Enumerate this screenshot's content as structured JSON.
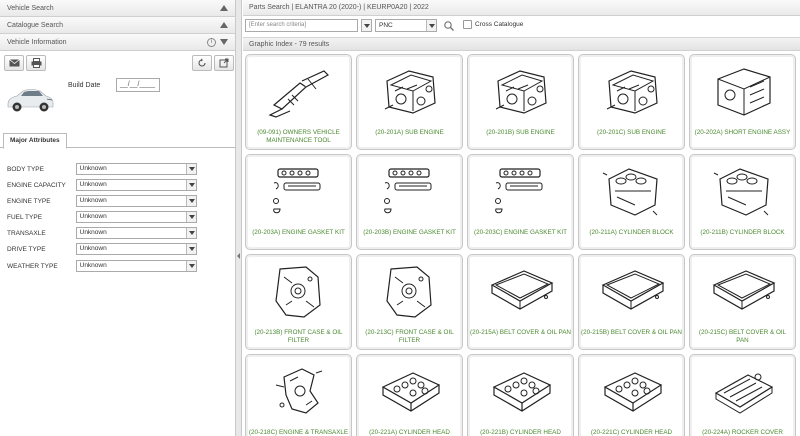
{
  "left_panel": {
    "accordions": [
      {
        "title": "Vehicle Search"
      },
      {
        "title": "Catalogue Search"
      },
      {
        "title": "Vehicle Information"
      }
    ],
    "build_date_label": "Build Date",
    "build_date_value": "__/__/____",
    "tab_label": "Major Attributes",
    "attributes": [
      {
        "label": "BODY TYPE",
        "value": "Unknown"
      },
      {
        "label": "ENGINE CAPACITY",
        "value": "Unknown"
      },
      {
        "label": "ENGINE TYPE",
        "value": "Unknown"
      },
      {
        "label": "FUEL TYPE",
        "value": "Unknown"
      },
      {
        "label": "TRANSAXLE",
        "value": "Unknown"
      },
      {
        "label": "DRIVE TYPE",
        "value": "Unknown"
      },
      {
        "label": "WEATHER TYPE",
        "value": "Unknown"
      }
    ]
  },
  "right_panel": {
    "breadcrumb": "Parts Search | ELANTRA 20 (2020-) | KEURP0A20 | 2022",
    "search_placeholder": "[Enter search criteria]",
    "search_type": "PNC",
    "cross_catalogue_label": "Cross Catalogue",
    "graphic_index_label": "Graphic Index - 79 results",
    "parts": [
      {
        "label": "(09-091) OWNERS VEHICLE MAINTENANCE TOOL",
        "icon": "jack-icon"
      },
      {
        "label": "(20-201A) SUB ENGINE",
        "icon": "engine-icon"
      },
      {
        "label": "(20-201B) SUB ENGINE",
        "icon": "engine-icon"
      },
      {
        "label": "(20-201C) SUB ENGINE",
        "icon": "engine-icon"
      },
      {
        "label": "(20-202A) SHORT ENGINE ASSY",
        "icon": "short-engine-icon"
      },
      {
        "label": "(20-203A) ENGINE GASKET KIT",
        "icon": "gasket-icon"
      },
      {
        "label": "(20-203B) ENGINE GASKET KIT",
        "icon": "gasket-icon"
      },
      {
        "label": "(20-203C) ENGINE GASKET KIT",
        "icon": "gasket-icon"
      },
      {
        "label": "(20-211A) CYLINDER BLOCK",
        "icon": "cylinder-block-icon"
      },
      {
        "label": "(20-211B) CYLINDER BLOCK",
        "icon": "cylinder-block-icon"
      },
      {
        "label": "(20-213B) FRONT CASE & OIL FILTER",
        "icon": "front-case-icon"
      },
      {
        "label": "(20-213C) FRONT CASE & OIL FILTER",
        "icon": "front-case-icon"
      },
      {
        "label": "(20-215A) BELT COVER & OIL PAN",
        "icon": "oil-pan-icon"
      },
      {
        "label": "(20-215B) BELT COVER & OIL PAN",
        "icon": "oil-pan-icon"
      },
      {
        "label": "(20-215C) BELT COVER & OIL PAN",
        "icon": "oil-pan-icon"
      },
      {
        "label": "(20-218C) ENGINE & TRANSAXLE",
        "icon": "mount-bracket-icon"
      },
      {
        "label": "(20-221A) CYLINDER HEAD",
        "icon": "cylinder-head-icon"
      },
      {
        "label": "(20-221B) CYLINDER HEAD",
        "icon": "cylinder-head-icon"
      },
      {
        "label": "(20-221C) CYLINDER HEAD",
        "icon": "cylinder-head-icon"
      },
      {
        "label": "(20-224A) ROCKER COVER",
        "icon": "rocker-cover-icon"
      }
    ]
  },
  "colors": {
    "caption_green": "#4a8a30",
    "header_gray": "#eaeaea"
  }
}
